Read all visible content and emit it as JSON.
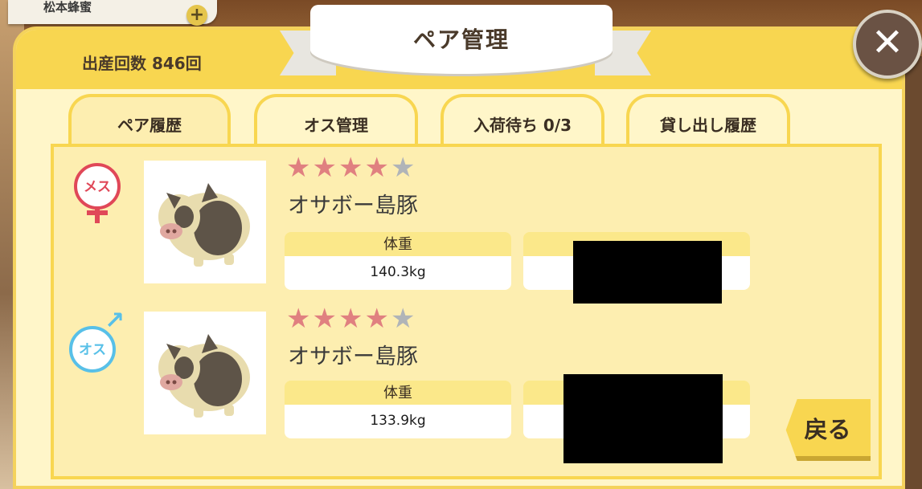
{
  "player": {
    "name": "松本蜂蜜",
    "plus_icon": "plus-icon"
  },
  "dialog": {
    "title": "ペア管理",
    "birth_count": "出産回数 846回",
    "close_icon": "close-icon"
  },
  "tabs": [
    {
      "label": "ペア履歴",
      "active": true
    },
    {
      "label": "オス管理",
      "active": false
    },
    {
      "label": "入荷待ち 0/3",
      "active": false
    },
    {
      "label": "貸し出し履歴",
      "active": false
    }
  ],
  "pairs": [
    {
      "gender_label": "メス",
      "gender_icon": "female-icon",
      "rating": 4,
      "rating_max": 5,
      "breed": "オサボー島豚",
      "weight_label": "体重",
      "weight_value": "140.3kg"
    },
    {
      "gender_label": "オス",
      "gender_icon": "male-icon",
      "rating": 4,
      "rating_max": 5,
      "breed": "オサボー島豚",
      "weight_label": "体重",
      "weight_value": "133.9kg"
    }
  ],
  "back_button": {
    "label": "戻る"
  },
  "colors": {
    "panel_bg": "#fff6c9",
    "header_yellow": "#f8d650",
    "star_on": "#e08080",
    "star_off": "#b0b4b8",
    "female": "#e04858",
    "male": "#58c0e8"
  }
}
